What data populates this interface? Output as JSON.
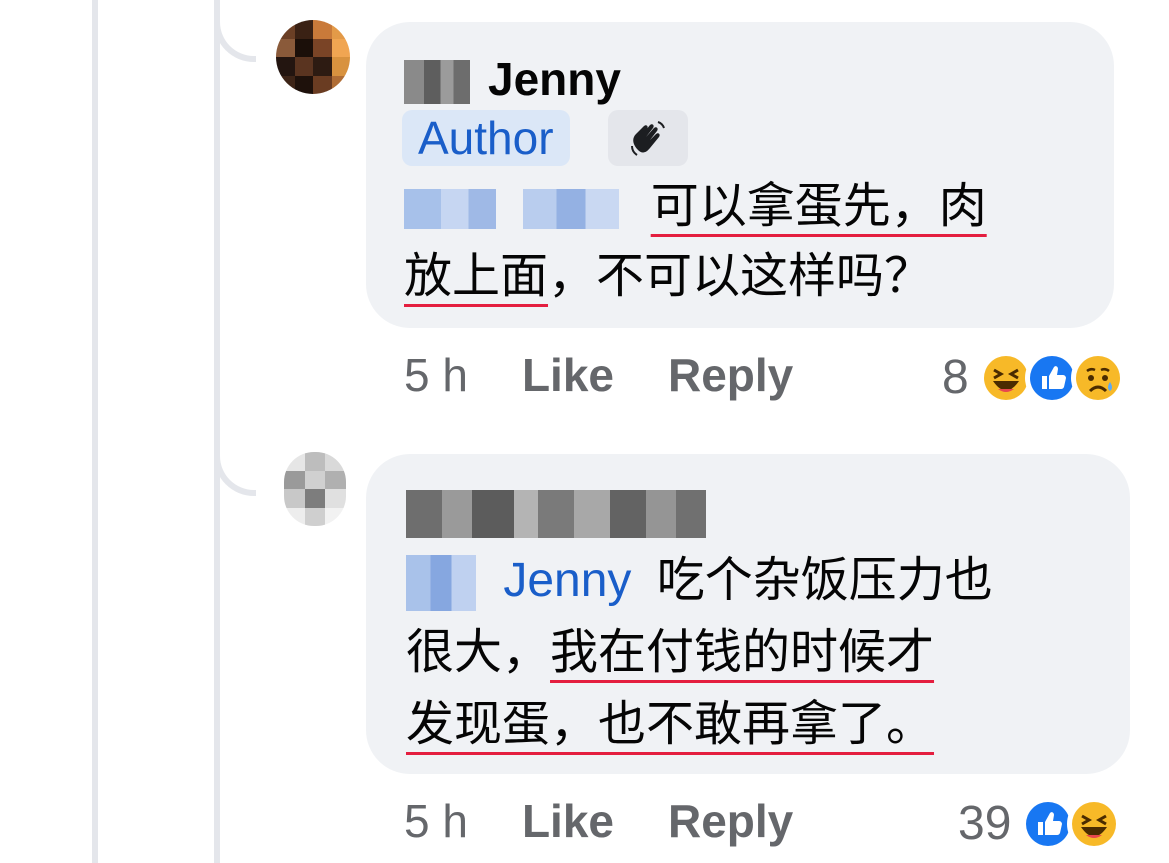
{
  "comments": [
    {
      "author_name": "Jenny",
      "author_badge": "Author",
      "mention": "",
      "line1": "可以拿蛋先，肉",
      "line2_underlined": "放上面",
      "line2_rest": "，不可以这样吗？",
      "time": "5 h",
      "like_label": "Like",
      "reply_label": "Reply",
      "reaction_count": "8",
      "reactions": [
        "haha-icon",
        "like-icon",
        "sad-icon"
      ]
    },
    {
      "author_name": "",
      "mention": "Jenny",
      "line1": "吃个杂饭压力也",
      "line2_plain": "很大，",
      "line2_underlined": "我在付钱的时候才",
      "line3_underlined": "发现蛋，也不敢再拿了。",
      "time": "5 h",
      "like_label": "Like",
      "reply_label": "Reply",
      "reaction_count": "39",
      "reactions": [
        "like-icon",
        "haha-icon"
      ]
    }
  ],
  "colors": {
    "bubble": "#f0f2f5",
    "link": "#1a5ec9",
    "underline": "#e41e3f",
    "muted": "#65676b"
  }
}
